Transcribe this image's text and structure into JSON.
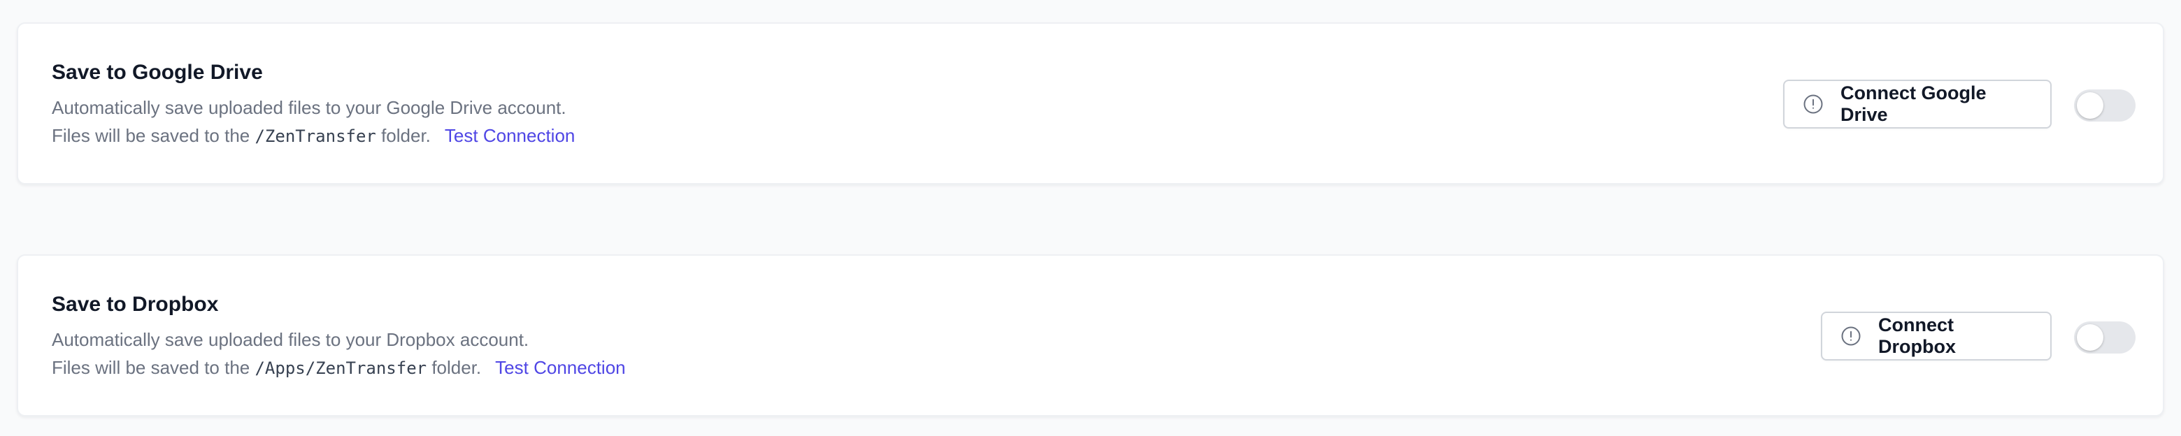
{
  "integrations": [
    {
      "title": "Save to Google Drive",
      "description": "Automatically save uploaded files to your Google Drive account.",
      "folder_prefix": "Files will be saved to the ",
      "folder_path": "/ZenTransfer",
      "folder_suffix": " folder.",
      "test_link": "Test Connection",
      "button_label": "Connect Google Drive",
      "button_icon": "alert-circle-icon",
      "enabled": false
    },
    {
      "title": "Save to Dropbox",
      "description": "Automatically save uploaded files to your Dropbox account.",
      "folder_prefix": "Files will be saved to the ",
      "folder_path": "/Apps/ZenTransfer",
      "folder_suffix": " folder.",
      "test_link": "Test Connection",
      "button_label": "Connect Dropbox",
      "button_icon": "alert-circle-icon",
      "enabled": false
    }
  ],
  "colors": {
    "link": "#4f46e5",
    "muted_text": "#6b7280",
    "toggle_off": "#e5e7eb",
    "border": "#d1d5db"
  }
}
